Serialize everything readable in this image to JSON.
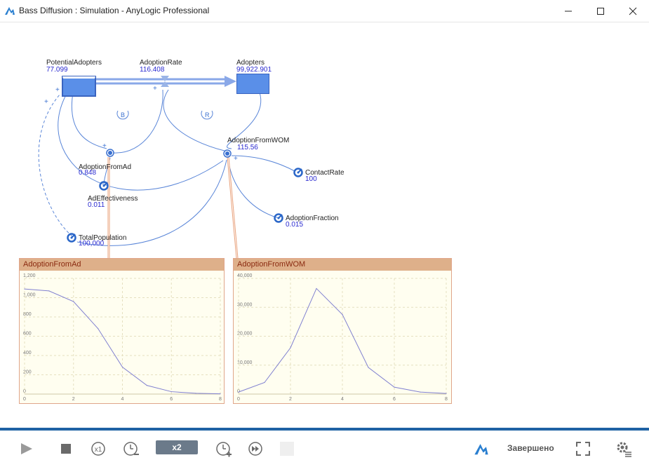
{
  "window": {
    "title": "Bass Diffusion : Simulation - AnyLogic Professional",
    "controls": [
      "minimize-icon",
      "maximize-icon",
      "close-icon"
    ]
  },
  "model": {
    "stocks": [
      {
        "name": "PotentialAdopters",
        "value": "77.099"
      },
      {
        "name": "Adopters",
        "value": "99,922.901"
      }
    ],
    "flows": [
      {
        "name": "AdoptionRate",
        "value": "116.408"
      }
    ],
    "variables": [
      {
        "name": "AdoptionFromAd",
        "value": "0.848"
      },
      {
        "name": "AdoptionFromWOM",
        "value": "115.56"
      }
    ],
    "parameters": [
      {
        "name": "ContactRate",
        "value": "100"
      },
      {
        "name": "AdEffectiveness",
        "value": "0.011"
      },
      {
        "name": "AdoptionFraction",
        "value": "0.015"
      },
      {
        "name": "TotalPopulation",
        "value": "100,000"
      }
    ],
    "loops": [
      {
        "label": "B"
      },
      {
        "label": "R"
      }
    ],
    "polarity_mark": "+"
  },
  "chart_data": [
    {
      "type": "line",
      "title": "AdoptionFromAd",
      "x": [
        0,
        1,
        2,
        3,
        4,
        5,
        6,
        7,
        8
      ],
      "series": [
        {
          "values": [
            1090,
            1070,
            960,
            680,
            280,
            90,
            25,
            8,
            3
          ]
        }
      ],
      "xlim": [
        0,
        8
      ],
      "ylim": [
        0,
        1200
      ],
      "xticks": [
        "0",
        "2",
        "4",
        "6",
        "8"
      ],
      "yticks": [
        "0",
        "200",
        "400",
        "600",
        "800",
        "1,000",
        "1,200"
      ],
      "grid": true,
      "colors": {
        "line": "#8080d0",
        "background": "#fffef0",
        "header": "#deb08a"
      }
    },
    {
      "type": "line",
      "title": "AdoptionFromWOM",
      "x": [
        0,
        1,
        2,
        3,
        4,
        5,
        6,
        7,
        8
      ],
      "series": [
        {
          "values": [
            700,
            4000,
            16000,
            36500,
            27500,
            9200,
            2400,
            700,
            200
          ]
        }
      ],
      "xlim": [
        0,
        8
      ],
      "ylim": [
        0,
        40000
      ],
      "xticks": [
        "0",
        "2",
        "4",
        "6",
        "8"
      ],
      "yticks": [
        "0",
        "10,000",
        "20,000",
        "30,000",
        "40,000"
      ],
      "grid": true,
      "colors": {
        "line": "#8080d0",
        "background": "#fffef0",
        "header": "#deb08a"
      }
    }
  ],
  "toolbar": {
    "speed_label": "x2",
    "status": "Завершено",
    "icons": [
      "play-icon",
      "stop-icon",
      "realtime-x1-icon",
      "slow-down-icon",
      "speed-up-icon",
      "fast-forward-icon",
      "step-icon",
      "anylogic-logo-icon",
      "fullscreen-icon",
      "settings-icon"
    ],
    "accent_color": "#1e62a4"
  }
}
